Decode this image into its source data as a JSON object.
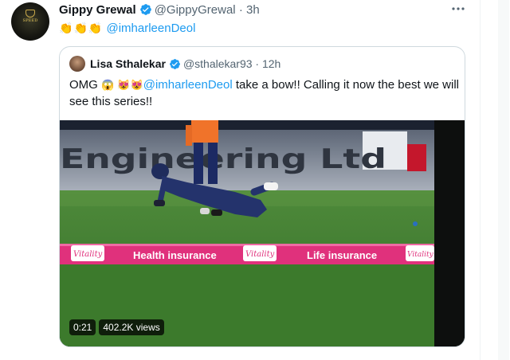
{
  "tweet": {
    "author_name": "Gippy Grewal",
    "handle": "@GippyGrewal",
    "separator": "·",
    "time": "3h",
    "claps": [
      "👏",
      "👏",
      "👏"
    ],
    "mention": "@imharleenDeol",
    "more_icon": "more-horizontal-icon"
  },
  "quote": {
    "author_name": "Lisa Sthalekar",
    "handle": "@sthalekar93",
    "separator": "·",
    "time": "12h",
    "text_start": "OMG ",
    "emoji_1": "😱",
    "emoji_2": "😻",
    "emoji_3": "😻",
    "mention": "@imharleenDeol",
    "text_end": " take a bow!! Calling it now the best we will see this series!!"
  },
  "video": {
    "duration": "0:21",
    "views": "402.2K views",
    "stand_sign": "Engineering Ltd",
    "board_1": "Vitality",
    "board_2": "Health insurance",
    "board_3": "Vitality",
    "board_4": "Life insurance",
    "board_5": "Vitality"
  },
  "colors": {
    "link": "#1d9bf0",
    "verified": "#1d9bf0",
    "secondary": "#536471",
    "boundary_pink": "#e0317c",
    "grass": "#3f7a2f"
  }
}
